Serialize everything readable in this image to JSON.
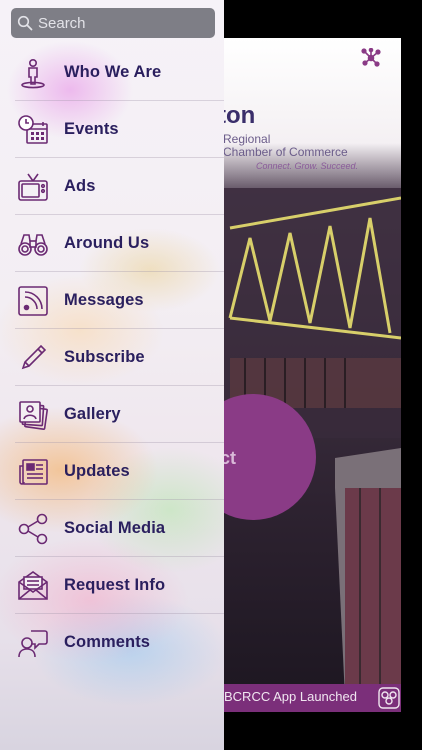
{
  "search": {
    "placeholder": "Search"
  },
  "menu": [
    {
      "label": "Who We Are",
      "icon": "person-icon"
    },
    {
      "label": "Events",
      "icon": "calendar-clock-icon"
    },
    {
      "label": "Ads",
      "icon": "tv-icon"
    },
    {
      "label": "Around Us",
      "icon": "binoculars-icon"
    },
    {
      "label": "Messages",
      "icon": "rss-icon"
    },
    {
      "label": "Subscribe",
      "icon": "pencil-icon"
    },
    {
      "label": "Gallery",
      "icon": "photos-icon"
    },
    {
      "label": "Updates",
      "icon": "newspaper-icon"
    },
    {
      "label": "Social Media",
      "icon": "share-icon"
    },
    {
      "label": "Request Info",
      "icon": "envelope-icon"
    },
    {
      "label": "Comments",
      "icon": "chat-person-icon"
    }
  ],
  "background": {
    "brand_word": "ton",
    "brand_line1": "Regional",
    "brand_line2": "Chamber of Commerce",
    "tagline": "Connect. Grow. Succeed.",
    "connect_label": "ect",
    "banner_text": "BCRCC App Launched"
  },
  "colors": {
    "accent_purple": "#8a3b86",
    "menu_text": "#2a1f5e",
    "icon_purple": "#6b2a73",
    "search_bg": "#7e7e86"
  }
}
